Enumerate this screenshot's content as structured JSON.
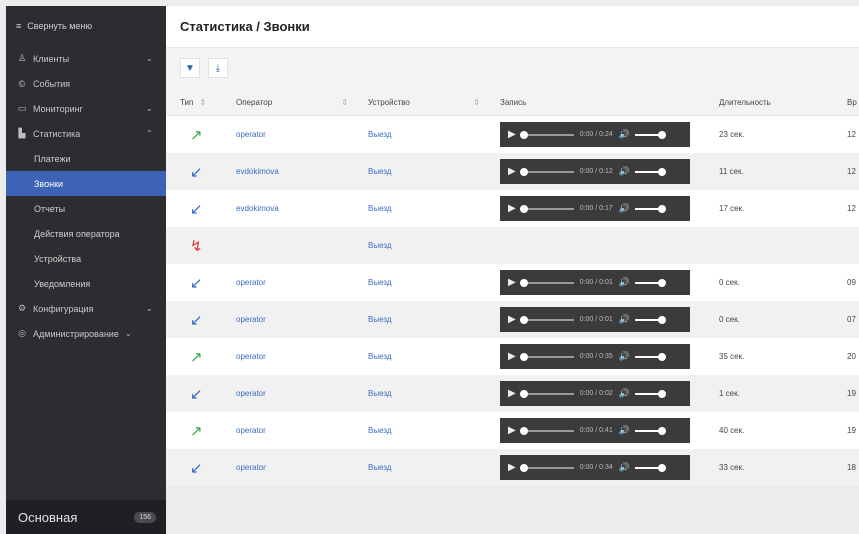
{
  "sidebar": {
    "collapse_label": "Свернуть меню",
    "items": [
      {
        "label": "Клиенты",
        "icon": "users-icon",
        "chevron": "down"
      },
      {
        "label": "События",
        "icon": "events-icon",
        "chevron": ""
      },
      {
        "label": "Мониторинг",
        "icon": "monitor-icon",
        "chevron": "down"
      },
      {
        "label": "Статистика",
        "icon": "chart-icon",
        "chevron": "up"
      }
    ],
    "sub_items": [
      {
        "label": "Платежи",
        "active": false
      },
      {
        "label": "Звонки",
        "active": true
      },
      {
        "label": "Отчеты",
        "active": false
      },
      {
        "label": "Действия оператора",
        "active": false
      },
      {
        "label": "Устройства",
        "active": false
      },
      {
        "label": "Уведомления",
        "active": false
      }
    ],
    "bottom_items": [
      {
        "label": "Конфигурация",
        "icon": "config-icon",
        "chevron": "down"
      },
      {
        "label": "Администрирование",
        "icon": "admin-icon",
        "chevron": "down"
      }
    ],
    "footer": {
      "name": "Основная",
      "badge": "156"
    }
  },
  "header": {
    "title": "Статистика / Звонки"
  },
  "toolbar": {
    "filter_icon": "filter-icon",
    "download_icon": "download-icon"
  },
  "table": {
    "columns": {
      "type": "Тип",
      "operator": "Оператор",
      "device": "Устройство",
      "record": "Запись",
      "duration": "Длительность",
      "time": "Вр"
    },
    "rows": [
      {
        "dir": "out",
        "operator": "operator",
        "device": "Выезд",
        "time": "0:00 / 0:24",
        "duration": "23 сек.",
        "clock": "12"
      },
      {
        "dir": "in",
        "operator": "evdokimova",
        "device": "Выезд",
        "time": "0:00 / 0:12",
        "duration": "11 сек.",
        "clock": "12"
      },
      {
        "dir": "in",
        "operator": "evdokimova",
        "device": "Выезд",
        "time": "0:00 / 0:17",
        "duration": "17 сек.",
        "clock": "12"
      },
      {
        "dir": "miss",
        "operator": "",
        "device": "Выезд",
        "time": "",
        "duration": "",
        "clock": ""
      },
      {
        "dir": "in",
        "operator": "operator",
        "device": "Выезд",
        "time": "0:00 / 0:01",
        "duration": "0 сек.",
        "clock": "09"
      },
      {
        "dir": "in",
        "operator": "operator",
        "device": "Выезд",
        "time": "0:00 / 0:01",
        "duration": "0 сек.",
        "clock": "07"
      },
      {
        "dir": "out",
        "operator": "operator",
        "device": "Выезд",
        "time": "0:00 / 0:35",
        "duration": "35 сек.",
        "clock": "20"
      },
      {
        "dir": "in",
        "operator": "operator",
        "device": "Выезд",
        "time": "0:00 / 0:02",
        "duration": "1 сек.",
        "clock": "19"
      },
      {
        "dir": "out",
        "operator": "operator",
        "device": "Выезд",
        "time": "0:00 / 0:41",
        "duration": "40 сек.",
        "clock": "19"
      },
      {
        "dir": "in",
        "operator": "operator",
        "device": "Выезд",
        "time": "0:00 / 0:34",
        "duration": "33 сек.",
        "clock": "18"
      }
    ]
  },
  "colors": {
    "accent": "#3d64b4",
    "sidebar_bg": "#2c2d30",
    "outgoing": "#3aa84a",
    "incoming": "#3a6cc0",
    "missed": "#e03a3a"
  }
}
